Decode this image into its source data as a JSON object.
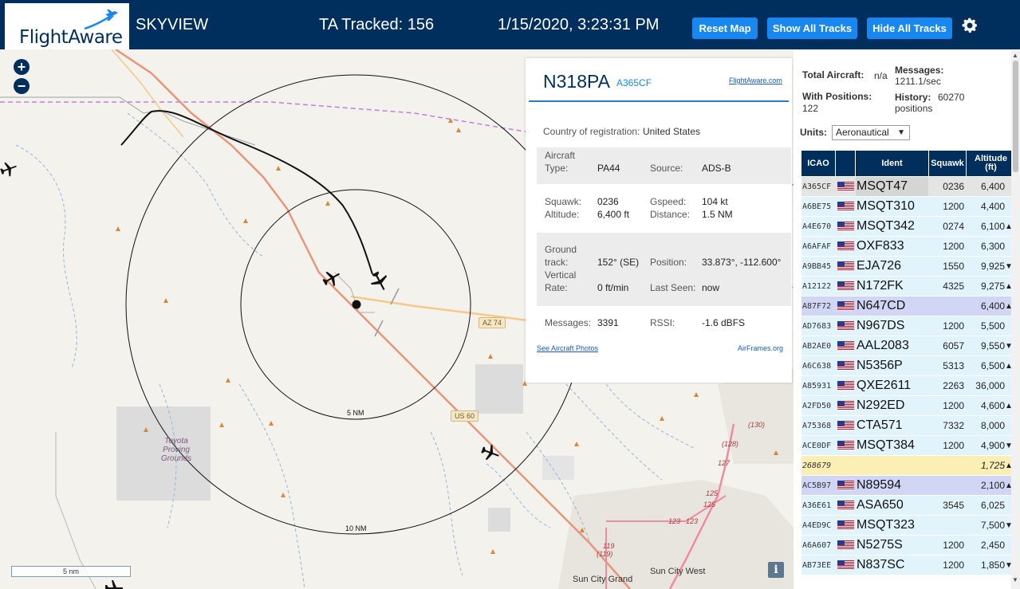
{
  "header": {
    "logo_text": "FlightAware",
    "app_name": "SKYVIEW",
    "tracked": "TA Tracked: 156",
    "datetime": "1/15/2020, 3:23:31 PM",
    "reset_map": "Reset Map",
    "show_all_tracks": "Show All Tracks",
    "hide_all_tracks": "Hide All Tracks",
    "settings_icon": "gear-icon"
  },
  "map": {
    "zoom_in": "+",
    "zoom_out": "−",
    "scale": "5 nm",
    "info": "i",
    "ring_labels": [
      "5 NM",
      "10 NM"
    ],
    "road_shields": [
      "AZ 74",
      "US 60"
    ],
    "road_numbers": [
      "(130)",
      "(128)",
      "127",
      "125",
      "125",
      "123",
      "123",
      "119",
      "(119)"
    ],
    "area_label": "Toyota\nProving\nGrounds",
    "place_labels": [
      "Sun City Grand",
      "Sun City West"
    ],
    "colors": {
      "land": "#f4f2ed",
      "highway": "#e8967a",
      "state_road": "#f5c989",
      "water": "#8fb8d8",
      "restricted": "#c27fd6"
    }
  },
  "popup": {
    "callsign": "N318PA",
    "icao": "A365CF",
    "flightaware_link": "FlightAware.com",
    "country_label": "Country of registration:",
    "country": "United States",
    "aircraft_type_label": "Aircraft\nType:",
    "aircraft_type": "PA44",
    "source_label": "Source:",
    "source": "ADS-B",
    "squawk_label": "Squawk:",
    "squawk": "0236",
    "gspeed_label": "Gspeed:",
    "gspeed": "104 kt",
    "altitude_label": "Altitude:",
    "altitude": "6,400 ft",
    "distance_label": "Distance:",
    "distance": "1.5 NM",
    "ground_track_label": "Ground\ntrack:",
    "ground_track": "152° (SE)",
    "position_label": "Position:",
    "position": "33.873°, -112.600°",
    "vertical_rate_label": "Vertical\nRate:",
    "vertical_rate": "0 ft/min",
    "last_seen_label": "Last Seen:",
    "last_seen": "now",
    "messages_label": "Messages:",
    "messages": "3391",
    "rssi_label": "RSSI:",
    "rssi": "-1.6 dBFS",
    "photos_link": "See Aircraft Photos",
    "airframes_link": "AirFrames.org"
  },
  "stats": {
    "total_aircraft_label": "Total Aircraft:",
    "total_aircraft": "n/a",
    "messages_label": "Messages:",
    "messages": "1211.1/sec",
    "with_positions_label": "With Positions:",
    "with_positions": "122",
    "history_label": "History:",
    "history": "60270",
    "history_unit": "positions",
    "units_label": "Units:",
    "units_value": "Aeronautical"
  },
  "table": {
    "columns": [
      "ICAO",
      "",
      "Ident",
      "Squawk",
      "Altitude\n(ft)"
    ],
    "rows": [
      {
        "icao": "A365CF",
        "flag": true,
        "ident": "MSQT47",
        "squawk": "0236",
        "alt": "6,400",
        "trend": "",
        "bg": "#e4e4e4",
        "selected": true
      },
      {
        "icao": "A6BE75",
        "flag": true,
        "ident": "MSQT310",
        "squawk": "1200",
        "alt": "4,400",
        "trend": "",
        "bg": "#e1f3fb"
      },
      {
        "icao": "A4E670",
        "flag": true,
        "ident": "MSQT342",
        "squawk": "0274",
        "alt": "6,100",
        "trend": "▲",
        "bg": "#e1f3fb"
      },
      {
        "icao": "A6AFAF",
        "flag": true,
        "ident": "OXF833",
        "squawk": "1200",
        "alt": "6,300",
        "trend": "",
        "bg": "#e1f3fb"
      },
      {
        "icao": "A9BB45",
        "flag": true,
        "ident": "EJA726",
        "squawk": "1550",
        "alt": "9,925",
        "trend": "▼",
        "bg": "#e1f3fb"
      },
      {
        "icao": "A12122",
        "flag": true,
        "ident": "N172FK",
        "squawk": "4325",
        "alt": "9,275",
        "trend": "▲",
        "bg": "#e1f3fb"
      },
      {
        "icao": "A87F72",
        "flag": true,
        "ident": "N647CD",
        "squawk": "",
        "alt": "6,400",
        "trend": "▲",
        "bg": "#d0d6f3"
      },
      {
        "icao": "AD7683",
        "flag": true,
        "ident": "N967DS",
        "squawk": "1200",
        "alt": "5,500",
        "trend": "",
        "bg": "#e1f3fb"
      },
      {
        "icao": "AB2AE0",
        "flag": true,
        "ident": "AAL2083",
        "squawk": "6057",
        "alt": "9,550",
        "trend": "▼",
        "bg": "#e1f3fb"
      },
      {
        "icao": "A6C638",
        "flag": true,
        "ident": "N5356P",
        "squawk": "5313",
        "alt": "6,500",
        "trend": "▲",
        "bg": "#e1f3fb"
      },
      {
        "icao": "A85931",
        "flag": true,
        "ident": "QXE2611",
        "squawk": "2263",
        "alt": "36,000",
        "trend": "",
        "bg": "#e1f3fb"
      },
      {
        "icao": "A2FD50",
        "flag": true,
        "ident": "N292ED",
        "squawk": "1200",
        "alt": "4,600",
        "trend": "▲",
        "bg": "#e1f3fb"
      },
      {
        "icao": "A75368",
        "flag": true,
        "ident": "CTA571",
        "squawk": "7332",
        "alt": "8,000",
        "trend": "",
        "bg": "#e1f3fb"
      },
      {
        "icao": "ACE0DF",
        "flag": true,
        "ident": "MSQT384",
        "squawk": "1200",
        "alt": "4,900",
        "trend": "▼",
        "bg": "#e1f3fb"
      },
      {
        "icao": "268679",
        "flag": false,
        "ident": "",
        "squawk": "",
        "alt": "1,725",
        "trend": "▲",
        "bg": "#fcefb6",
        "italic": true
      },
      {
        "icao": "AC5B97",
        "flag": true,
        "ident": "N89594",
        "squawk": "",
        "alt": "2,100",
        "trend": "▲",
        "bg": "#d0d6f3"
      },
      {
        "icao": "A36E61",
        "flag": true,
        "ident": "ASA650",
        "squawk": "3545",
        "alt": "6,025",
        "trend": "",
        "bg": "#e1f3fb"
      },
      {
        "icao": "A4ED9C",
        "flag": true,
        "ident": "MSQT323",
        "squawk": "",
        "alt": "7,500",
        "trend": "▼",
        "bg": "#e1f3fb"
      },
      {
        "icao": "A6A607",
        "flag": true,
        "ident": "N5275S",
        "squawk": "1200",
        "alt": "2,450",
        "trend": "",
        "bg": "#e1f3fb"
      },
      {
        "icao": "AB73EE",
        "flag": true,
        "ident": "N837SC",
        "squawk": "1200",
        "alt": "1,850",
        "trend": "▼",
        "bg": "#e1f3fb"
      }
    ]
  }
}
